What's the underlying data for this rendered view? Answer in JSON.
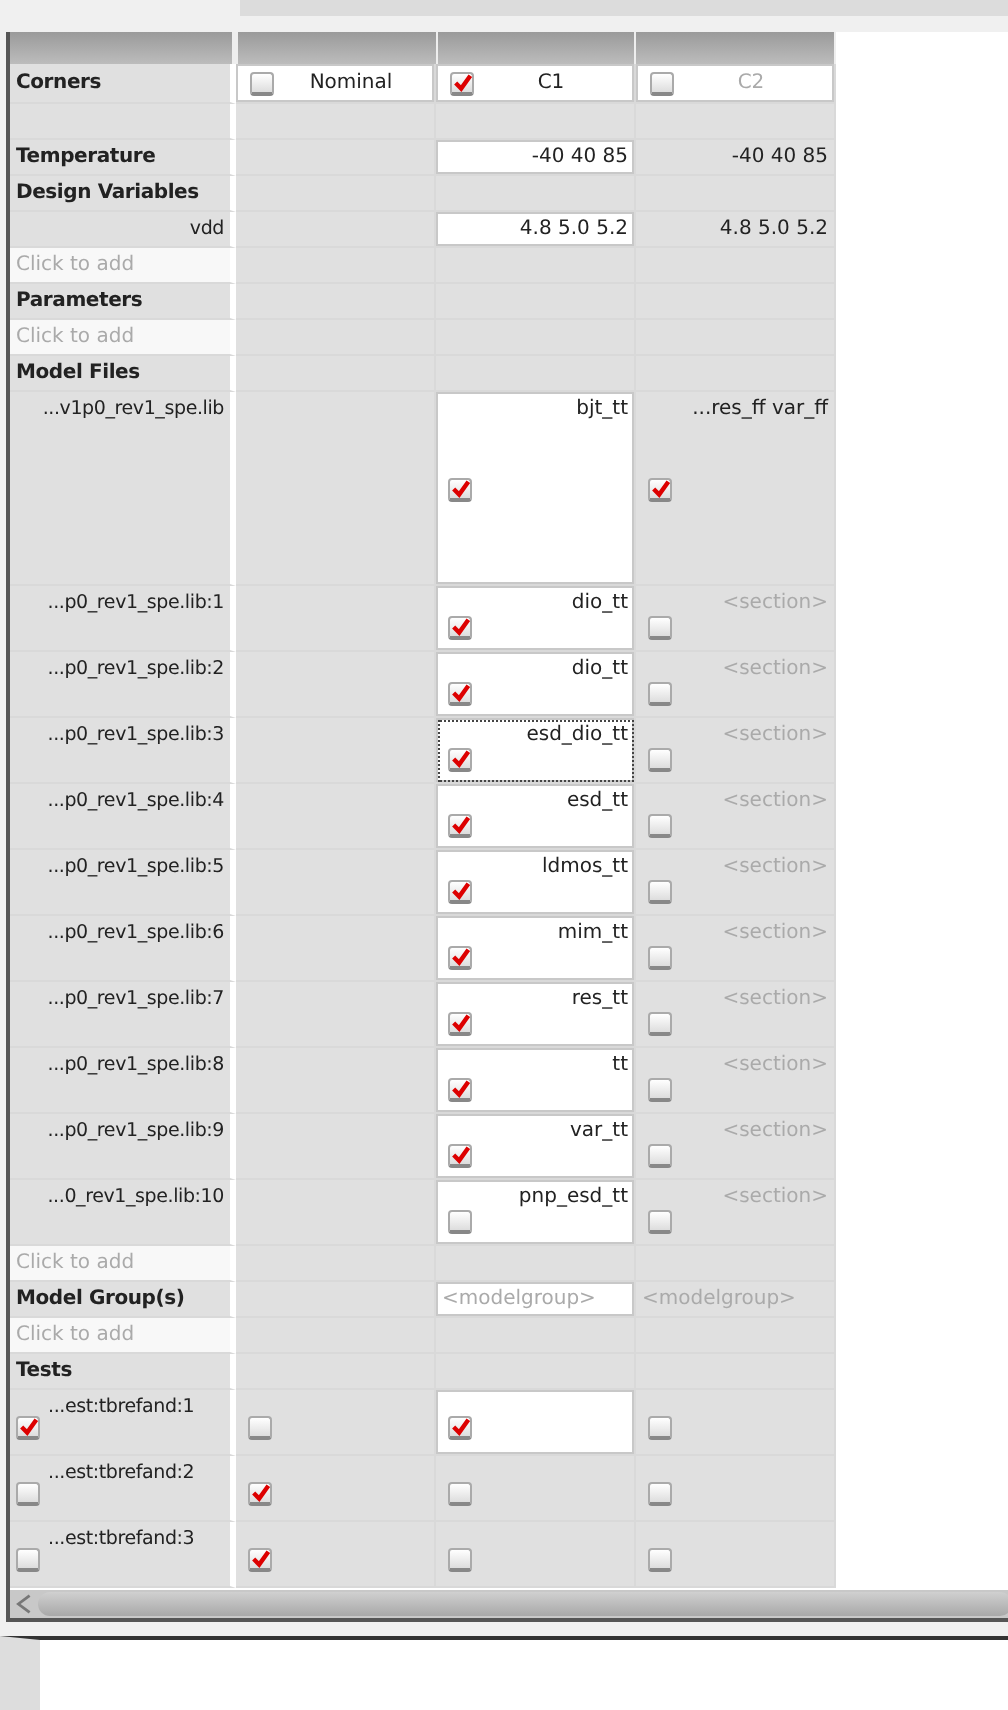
{
  "corners": {
    "label": "Corners",
    "columns": [
      {
        "name": "Nominal",
        "checked": false,
        "disabled": false
      },
      {
        "name": "C1",
        "checked": true,
        "disabled": false
      },
      {
        "name": "C2",
        "checked": false,
        "disabled": true
      }
    ]
  },
  "rows": [
    {
      "kind": "blank"
    },
    {
      "kind": "section",
      "label": "Temperature",
      "cells": [
        {
          "highlighted": false
        },
        {
          "text": "-40 40 85",
          "highlighted": true
        },
        {
          "text": "-40 40 85",
          "highlighted": false
        }
      ]
    },
    {
      "kind": "section",
      "label": "Design Variables"
    },
    {
      "kind": "value",
      "label": "vdd",
      "cells": [
        {
          "highlighted": false
        },
        {
          "text": "4.8 5.0 5.2",
          "highlighted": true
        },
        {
          "text": "4.8 5.0 5.2",
          "highlighted": false
        }
      ]
    },
    {
      "kind": "add",
      "placeholder": "Click to add"
    },
    {
      "kind": "section",
      "label": "Parameters"
    },
    {
      "kind": "add",
      "placeholder": "Click to add"
    },
    {
      "kind": "section",
      "label": "Model Files"
    },
    {
      "kind": "multiline",
      "label": "...v1p0_rev1_spe.lib",
      "cells": [
        {
          "highlighted": false
        },
        {
          "text": "bjt_tt",
          "checked": true,
          "highlighted": true,
          "focused": false
        },
        {
          "text": "...res_ff var_ff",
          "checked": true,
          "highlighted": false,
          "focused": false
        }
      ]
    },
    {
      "kind": "model",
      "label": "...p0_rev1_spe.lib:1",
      "cells": [
        {
          "highlighted": false
        },
        {
          "text": "dio_tt",
          "checked": true,
          "highlighted": true,
          "focused": false
        },
        {
          "placeholder": "<section>",
          "checked": false,
          "highlighted": false,
          "focused": false
        }
      ]
    },
    {
      "kind": "model",
      "label": "...p0_rev1_spe.lib:2",
      "cells": [
        {
          "highlighted": false
        },
        {
          "text": "dio_tt",
          "checked": true,
          "highlighted": true,
          "focused": false
        },
        {
          "placeholder": "<section>",
          "checked": false,
          "highlighted": false,
          "focused": false
        }
      ]
    },
    {
      "kind": "model",
      "label": "...p0_rev1_spe.lib:3",
      "cells": [
        {
          "highlighted": false
        },
        {
          "text": "esd_dio_tt",
          "checked": true,
          "highlighted": true,
          "focused": true
        },
        {
          "placeholder": "<section>",
          "checked": false,
          "highlighted": false,
          "focused": false
        }
      ]
    },
    {
      "kind": "model",
      "label": "...p0_rev1_spe.lib:4",
      "cells": [
        {
          "highlighted": false
        },
        {
          "text": "esd_tt",
          "checked": true,
          "highlighted": true,
          "focused": false
        },
        {
          "placeholder": "<section>",
          "checked": false,
          "highlighted": false,
          "focused": false
        }
      ]
    },
    {
      "kind": "model",
      "label": "...p0_rev1_spe.lib:5",
      "cells": [
        {
          "highlighted": false
        },
        {
          "text": "ldmos_tt",
          "checked": true,
          "highlighted": true,
          "focused": false
        },
        {
          "placeholder": "<section>",
          "checked": false,
          "highlighted": false,
          "focused": false
        }
      ]
    },
    {
      "kind": "model",
      "label": "...p0_rev1_spe.lib:6",
      "cells": [
        {
          "highlighted": false
        },
        {
          "text": "mim_tt",
          "checked": true,
          "highlighted": true,
          "focused": false
        },
        {
          "placeholder": "<section>",
          "checked": false,
          "highlighted": false,
          "focused": false
        }
      ]
    },
    {
      "kind": "model",
      "label": "...p0_rev1_spe.lib:7",
      "cells": [
        {
          "highlighted": false
        },
        {
          "text": "res_tt",
          "checked": true,
          "highlighted": true,
          "focused": false
        },
        {
          "placeholder": "<section>",
          "checked": false,
          "highlighted": false,
          "focused": false
        }
      ]
    },
    {
      "kind": "model",
      "label": "...p0_rev1_spe.lib:8",
      "cells": [
        {
          "highlighted": false
        },
        {
          "text": "tt",
          "checked": true,
          "highlighted": true,
          "focused": false
        },
        {
          "placeholder": "<section>",
          "checked": false,
          "highlighted": false,
          "focused": false
        }
      ]
    },
    {
      "kind": "model",
      "label": "...p0_rev1_spe.lib:9",
      "cells": [
        {
          "highlighted": false
        },
        {
          "text": "var_tt",
          "checked": true,
          "highlighted": true,
          "focused": false
        },
        {
          "placeholder": "<section>",
          "checked": false,
          "highlighted": false,
          "focused": false
        }
      ]
    },
    {
      "kind": "model",
      "label": "...0_rev1_spe.lib:10",
      "cells": [
        {
          "highlighted": false
        },
        {
          "text": "pnp_esd_tt",
          "checked": false,
          "highlighted": true,
          "focused": false
        },
        {
          "placeholder": "<section>",
          "checked": false,
          "highlighted": false,
          "focused": false
        }
      ]
    },
    {
      "kind": "add",
      "placeholder": "Click to add"
    },
    {
      "kind": "section",
      "label": "Model Group(s)",
      "cells": [
        {
          "highlighted": false
        },
        {
          "placeholder": "<modelgroup>",
          "highlighted": true
        },
        {
          "placeholder": "<modelgroup>",
          "highlighted": false
        }
      ]
    },
    {
      "kind": "add",
      "placeholder": "Click to add"
    },
    {
      "kind": "section",
      "label": "Tests"
    },
    {
      "kind": "test",
      "label": "...est:tbrefand:1",
      "checked": true,
      "cells": [
        {
          "checked": false,
          "highlighted": false
        },
        {
          "checked": true,
          "highlighted": true
        },
        {
          "checked": false,
          "highlighted": false
        }
      ]
    },
    {
      "kind": "test",
      "label": "...est:tbrefand:2",
      "checked": false,
      "cells": [
        {
          "checked": true,
          "highlighted": false
        },
        {
          "checked": false,
          "highlighted": false
        },
        {
          "checked": false,
          "highlighted": false
        }
      ]
    },
    {
      "kind": "test",
      "label": "...est:tbrefand:3",
      "checked": false,
      "cells": [
        {
          "checked": true,
          "highlighted": false
        },
        {
          "checked": false,
          "highlighted": false
        },
        {
          "checked": false,
          "highlighted": false
        }
      ]
    }
  ]
}
